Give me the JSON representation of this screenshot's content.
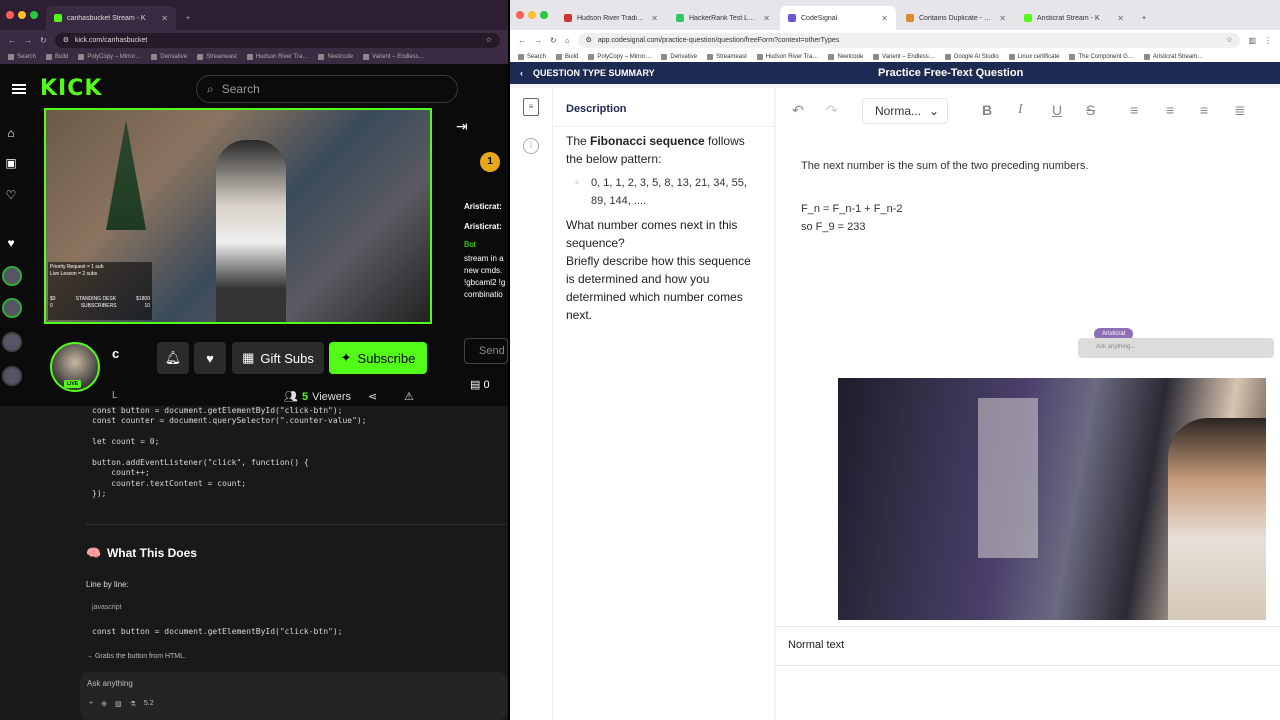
{
  "left_browser": {
    "tabs": [
      {
        "label": "canhasbucket Stream - K",
        "active": true
      },
      {
        "label": "+",
        "active": false
      }
    ],
    "url": "kick.com/canhasbucket",
    "bookmarks": [
      "Search",
      "Build",
      "PolyCopy – Mirror…",
      "Derivative",
      "Streameast",
      "Hudson River Tra…",
      "Neetcode",
      "Varient – Endless…"
    ]
  },
  "kick": {
    "logo": "KICK",
    "search_placeholder": "Search",
    "overlay": {
      "line1": "Priority Request = 1 sub",
      "line2": "Live Lesson = 2 subs",
      "rows": [
        [
          "$0",
          "STANDING DESK",
          "$1800"
        ],
        [
          "0",
          "SUBSCRIBERS",
          "10"
        ]
      ]
    },
    "chat": {
      "badge_count": "1",
      "users": [
        "Aristicrat:",
        "Aristicrat:",
        "Bot"
      ],
      "snippet": [
        "stream in a",
        "new cmds.",
        "!gbcaml2 !g",
        "combinatio"
      ],
      "send_label": "Send",
      "store_count": "0"
    },
    "streamer_initial": "c",
    "streamer_sub": "L",
    "live_badge": "LIVE",
    "buttons": {
      "gift_subs": "Gift Subs",
      "subscribe": "Subscribe"
    },
    "viewers_count": "5",
    "viewers_label": "Viewers"
  },
  "code_panel": {
    "top_lines": [
      "const button = document.getElementById(\"click-btn\");",
      "const counter = document.querySelector(\".counter-value\");",
      "",
      "let count = 0;",
      "",
      "button.addEventListener(\"click\", function() {",
      "    count++;",
      "    counter.textContent = count;",
      "});"
    ],
    "heading_emoji": "🧠",
    "heading": "What This Does",
    "line_by_line": "Line by line:",
    "lang": "javascript",
    "snippet": "const button = document.getElementById(\"click-btn\");",
    "note": "→ Grabs the button from HTML.",
    "ask_placeholder": "Ask anything",
    "ask_model": "5.2"
  },
  "right_browser": {
    "tabs": [
      {
        "label": "Hudson River Trading Invitati",
        "active": false
      },
      {
        "label": "HackerRank Test Login",
        "active": false
      },
      {
        "label": "CodeSignal",
        "active": true
      },
      {
        "label": "Contains Duplicate - NeetCo",
        "active": false
      },
      {
        "label": "Aristicrat Stream - K",
        "active": false
      }
    ],
    "url": "app.codesignal.com/practice-question/question/freeForm?context=otherTypes",
    "bookmarks": [
      "Search",
      "Build",
      "PolyCopy – Mirror…",
      "Derivative",
      "Streameast",
      "Hudson River Tra…",
      "Neetcode",
      "Varient – Endless…",
      "Google AI Studio",
      "Linux certificate",
      "The Component G…",
      "Aristicrat Stream…"
    ]
  },
  "codesignal": {
    "back_label": "QUESTION TYPE SUMMARY",
    "page_title": "Practice Free-Text Question",
    "description_title": "Description",
    "desc_intro_prefix": "The ",
    "desc_intro_bold": "Fibonacci sequence",
    "desc_intro_suffix": " follows the below pattern:",
    "sequence": "0, 1, 1, 2, 3, 5, 8, 13, 21, 34, 55, 89, 144, ....",
    "question1": "What number comes next in this sequence?",
    "question2": "Briefly describe how this sequence is determined and how you determined which number comes next.",
    "format_select": "Norma...",
    "answer_line1": "The next number is the sum of the two preceding numbers.",
    "answer_line2": "F_n = F_n-1 + F_n-2",
    "answer_line3": "so F_9 = 233",
    "status_bar": "Normal text",
    "floater_name": "Aristicrat",
    "floater_placeholder": "Ask anything..."
  }
}
